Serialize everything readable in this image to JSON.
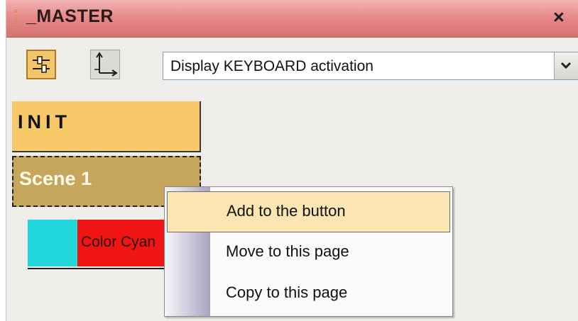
{
  "window": {
    "title": "_MASTER",
    "close_label": "×"
  },
  "toolbar": {
    "mixer_icon": "mixer-sliders-icon",
    "axes_icon": "axes-icon",
    "display_select": {
      "value": "Display KEYBOARD activation",
      "arrow_icon": "chevron-down-icon"
    }
  },
  "scene_buttons": [
    {
      "label": "INIT",
      "color": "#f7c968"
    },
    {
      "label": "Scene 1",
      "color": "#c6a65d"
    }
  ],
  "color_item": {
    "label": "Color Cyan",
    "swatch_color": "#22d7dc",
    "label_color": "#ee1512"
  },
  "context_menu": {
    "items": [
      {
        "label": "Add to the button",
        "highlighted": true
      },
      {
        "label": "Move to this page"
      },
      {
        "label": "Copy to this page"
      }
    ]
  }
}
